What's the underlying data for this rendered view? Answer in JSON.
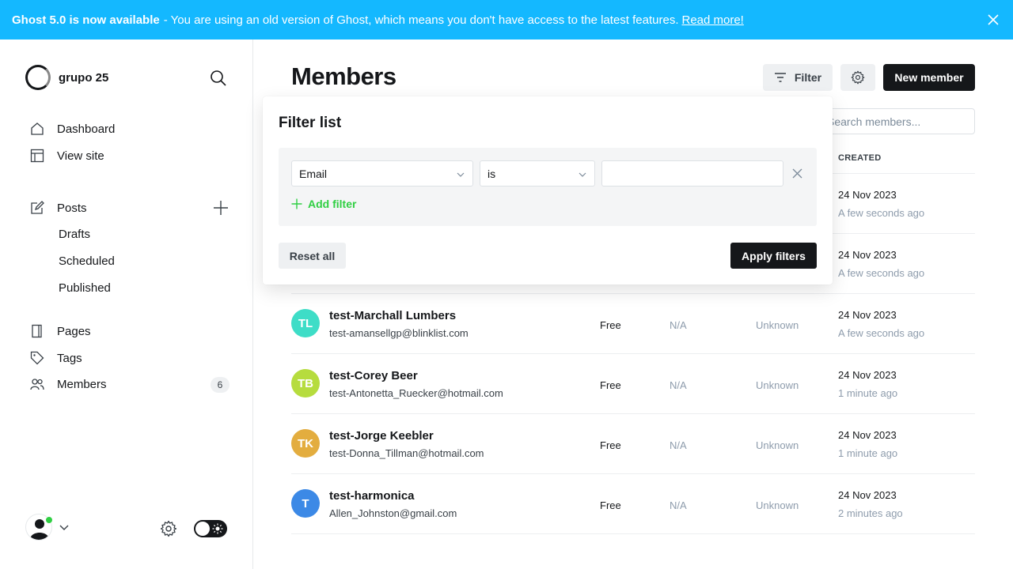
{
  "banner": {
    "headline": "Ghost 5.0 is now available",
    "message": "- You are using an old version of Ghost, which means you don't have access to the latest features.",
    "link": "Read more!"
  },
  "sidebar": {
    "site_name": "grupo 25",
    "nav": [
      {
        "label": "Dashboard",
        "icon": "home-icon"
      },
      {
        "label": "View site",
        "icon": "layout-icon"
      },
      {
        "label": "Posts",
        "icon": "edit-icon"
      },
      {
        "label": "Pages",
        "icon": "pages-icon"
      },
      {
        "label": "Tags",
        "icon": "tag-icon"
      },
      {
        "label": "Members",
        "icon": "members-icon"
      }
    ],
    "posts_sub": [
      "Drafts",
      "Scheduled",
      "Published"
    ],
    "members_count": "6"
  },
  "main": {
    "title": "Members",
    "filter_label": "Filter",
    "new_member_label": "New member",
    "search_placeholder": "Search members...",
    "col_created": "CREATED"
  },
  "filter_popover": {
    "title": "Filter list",
    "field": "Email",
    "operator": "is",
    "value": "",
    "add_filter": "Add filter",
    "reset": "Reset all",
    "apply": "Apply filters"
  },
  "members": [
    {
      "initials": "",
      "name": "",
      "email": "",
      "status": "",
      "open_rate": "",
      "location": "",
      "created_date": "24 Nov 2023",
      "created_ago": "A few seconds ago"
    },
    {
      "initials": "",
      "name": "",
      "email": "",
      "status": "",
      "open_rate": "",
      "location": "",
      "created_date": "24 Nov 2023",
      "created_ago": "A few seconds ago"
    },
    {
      "initials": "TL",
      "color": "#3eddc7",
      "name": "test-Marchall Lumbers",
      "email": "test-amansellgp@blinklist.com",
      "status": "Free",
      "open_rate": "N/A",
      "location": "Unknown",
      "created_date": "24 Nov 2023",
      "created_ago": "A few seconds ago"
    },
    {
      "initials": "TB",
      "color": "#b6dc3e",
      "name": "test-Corey Beer",
      "email": "test-Antonetta_Ruecker@hotmail.com",
      "status": "Free",
      "open_rate": "N/A",
      "location": "Unknown",
      "created_date": "24 Nov 2023",
      "created_ago": "1 minute ago"
    },
    {
      "initials": "TK",
      "color": "#e3ad3f",
      "name": "test-Jorge Keebler",
      "email": "test-Donna_Tillman@hotmail.com",
      "status": "Free",
      "open_rate": "N/A",
      "location": "Unknown",
      "created_date": "24 Nov 2023",
      "created_ago": "1 minute ago"
    },
    {
      "initials": "T",
      "color": "#3c89e6",
      "name": "test-harmonica",
      "email": "Allen_Johnston@gmail.com",
      "status": "Free",
      "open_rate": "N/A",
      "location": "Unknown",
      "created_date": "24 Nov 2023",
      "created_ago": "2 minutes ago"
    }
  ]
}
